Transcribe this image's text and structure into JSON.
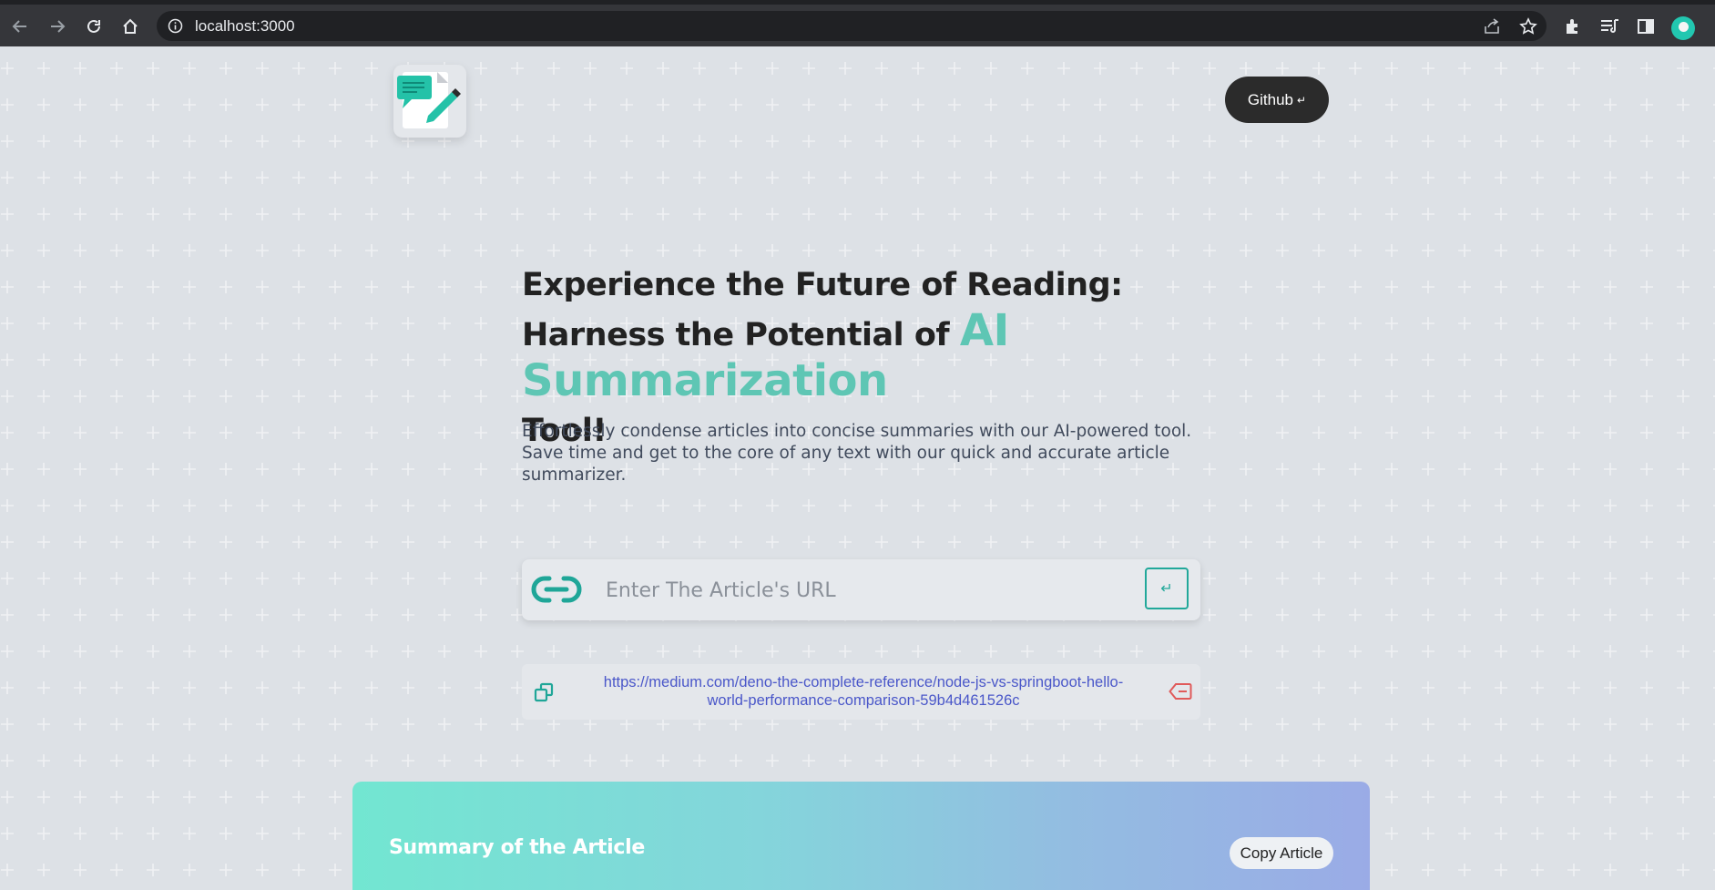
{
  "browser": {
    "url": "localhost:3000",
    "nav": {
      "back_icon": "back-arrow-icon",
      "forward_icon": "forward-arrow-icon",
      "reload_icon": "reload-icon",
      "home_icon": "home-icon"
    },
    "toolbar_icons": [
      "share-icon",
      "star-icon",
      "extensions-icon",
      "reading-list-icon",
      "side-panel-icon",
      "profile-avatar"
    ]
  },
  "header": {
    "logo_icon": "notepad-pencil-logo",
    "github_label": "Github",
    "github_icon": "↵"
  },
  "hero": {
    "headline_part1": "Experience the Future of Reading: Harness the Potential of ",
    "headline_accent": "AI Summarization",
    "headline_part2": "Tool!",
    "description": "Effortlessly condense articles into concise summaries with our AI-powered tool. Save time and get to the core of any text with our quick and accurate article summarizer."
  },
  "search": {
    "placeholder": "Enter The Article's URL",
    "value": "",
    "submit_icon": "↵"
  },
  "history": [
    {
      "url": "https://medium.com/deno-the-complete-reference/node-js-vs-springboot-hello-world-performance-comparison-59b4d461526c"
    }
  ],
  "summary": {
    "title": "Summary of the Article",
    "copy_label": "Copy Article"
  },
  "colors": {
    "accent": "#5ec6b4",
    "teal": "#21a89a",
    "link": "#4a57c9",
    "delete": "#e05a5a",
    "dark_button": "#2b2b2b",
    "page_bg": "#dde1e6"
  }
}
